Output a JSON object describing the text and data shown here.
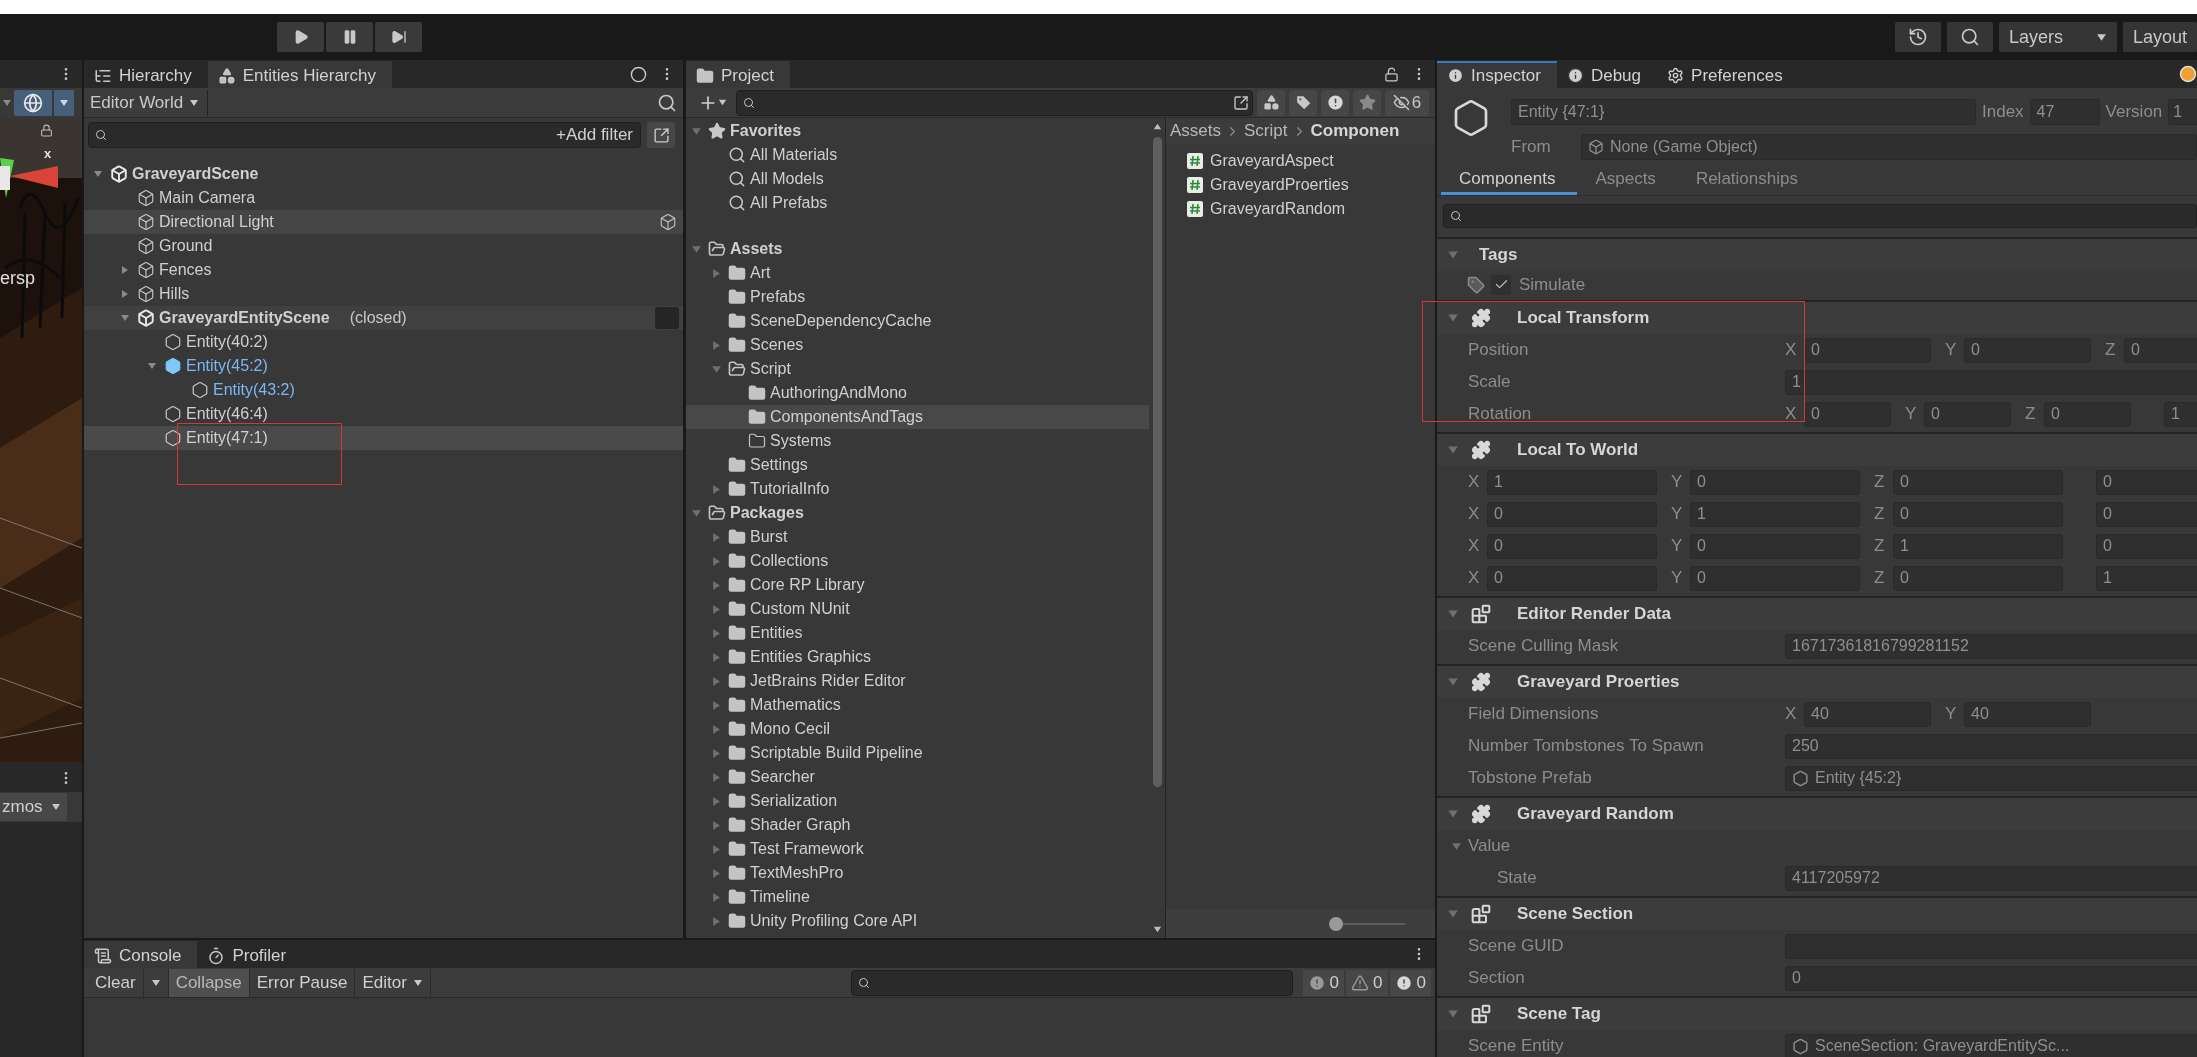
{
  "toolbar": {
    "layers": "Layers",
    "layout": "Layout"
  },
  "scene_view": {
    "view_label": "ersp",
    "axis_label": "x",
    "gizmos": "zmos"
  },
  "hierarchy": {
    "tabs": [
      {
        "label": "Hierarchy",
        "kind": "list",
        "selected": false
      },
      {
        "label": "Entities Hierarchy",
        "kind": "entities",
        "selected": true
      }
    ],
    "world": "Editor World",
    "add_filter": "+Add filter",
    "items": [
      {
        "label": "GraveyardScene",
        "kind": "scene",
        "expanded": true,
        "selected": false,
        "hovered": false,
        "children": [
          {
            "label": "Main Camera",
            "kind": "gameobject",
            "selected": false,
            "hovered": false
          },
          {
            "label": "Directional Light",
            "kind": "gameobject",
            "selected": false,
            "hovered": true
          },
          {
            "label": "Ground",
            "kind": "gameobject",
            "selected": false,
            "hovered": false
          },
          {
            "label": "Fences",
            "kind": "gameobject",
            "expanded": false,
            "selected": false,
            "hovered": false
          },
          {
            "label": "Hills",
            "kind": "gameobject",
            "expanded": false,
            "selected": false,
            "hovered": false
          },
          {
            "label": "GraveyardEntityScene",
            "note": "(closed)",
            "kind": "subscene",
            "expanded": true,
            "checked": false,
            "selected": false,
            "hovered": false,
            "children": [
              {
                "label": "Entity(40:2)",
                "kind": "entity",
                "selected": false,
                "hovered": false
              },
              {
                "label": "Entity(45:2)",
                "kind": "prefab-root",
                "expanded": true,
                "selected": false,
                "hovered": false,
                "children": [
                  {
                    "label": "Entity(43:2)",
                    "kind": "prefab-part",
                    "selected": false,
                    "hovered": false
                  }
                ]
              },
              {
                "label": "Entity(46:4)",
                "kind": "entity",
                "selected": false,
                "hovered": false
              },
              {
                "label": "Entity(47:1)",
                "kind": "entity",
                "selected": true,
                "hovered": false
              }
            ]
          }
        ]
      }
    ]
  },
  "project": {
    "tabs": [
      {
        "label": "Project",
        "selected": true
      }
    ],
    "hidden_count": "6",
    "tree": [
      {
        "label": "Favorites",
        "kind": "favorites",
        "expanded": true,
        "selected": false,
        "children": [
          {
            "label": "All Materials",
            "kind": "search",
            "selected": false
          },
          {
            "label": "All Models",
            "kind": "search",
            "selected": false
          },
          {
            "label": "All Prefabs",
            "kind": "search",
            "selected": false
          }
        ]
      },
      {
        "label": "Assets",
        "kind": "folder",
        "expanded": true,
        "selected": false,
        "children": [
          {
            "label": "Art",
            "kind": "folder",
            "expanded": false,
            "selected": false
          },
          {
            "label": "Prefabs",
            "kind": "folder",
            "selected": false
          },
          {
            "label": "SceneDependencyCache",
            "kind": "folder",
            "selected": false
          },
          {
            "label": "Scenes",
            "kind": "folder",
            "expanded": false,
            "selected": false
          },
          {
            "label": "Script",
            "kind": "folder",
            "expanded": true,
            "selected": false,
            "children": [
              {
                "label": "AuthoringAndMono",
                "kind": "folder",
                "selected": false
              },
              {
                "label": "ComponentsAndTags",
                "kind": "folder",
                "selected": true
              },
              {
                "label": "Systems",
                "kind": "empty-folder",
                "selected": false
              }
            ]
          },
          {
            "label": "Settings",
            "kind": "folder",
            "selected": false
          },
          {
            "label": "TutorialInfo",
            "kind": "folder",
            "expanded": false,
            "selected": false
          }
        ]
      },
      {
        "label": "Packages",
        "kind": "folder",
        "expanded": true,
        "selected": false,
        "children": [
          {
            "label": "Burst",
            "kind": "folder",
            "expanded": false,
            "selected": false
          },
          {
            "label": "Collections",
            "kind": "folder",
            "expanded": false,
            "selected": false
          },
          {
            "label": "Core RP Library",
            "kind": "folder",
            "expanded": false,
            "selected": false
          },
          {
            "label": "Custom NUnit",
            "kind": "folder",
            "expanded": false,
            "selected": false
          },
          {
            "label": "Entities",
            "kind": "folder",
            "expanded": false,
            "selected": false
          },
          {
            "label": "Entities Graphics",
            "kind": "folder",
            "expanded": false,
            "selected": false
          },
          {
            "label": "JetBrains Rider Editor",
            "kind": "folder",
            "expanded": false,
            "selected": false
          },
          {
            "label": "Mathematics",
            "kind": "folder",
            "expanded": false,
            "selected": false
          },
          {
            "label": "Mono Cecil",
            "kind": "folder",
            "expanded": false,
            "selected": false
          },
          {
            "label": "Scriptable Build Pipeline",
            "kind": "folder",
            "expanded": false,
            "selected": false
          },
          {
            "label": "Searcher",
            "kind": "folder",
            "expanded": false,
            "selected": false
          },
          {
            "label": "Serialization",
            "kind": "folder",
            "expanded": false,
            "selected": false
          },
          {
            "label": "Shader Graph",
            "kind": "folder",
            "expanded": false,
            "selected": false
          },
          {
            "label": "Test Framework",
            "kind": "folder",
            "expanded": false,
            "selected": false
          },
          {
            "label": "TextMeshPro",
            "kind": "folder",
            "expanded": false,
            "selected": false
          },
          {
            "label": "Timeline",
            "kind": "folder",
            "expanded": false,
            "selected": false
          },
          {
            "label": "Unity Profiling Core API",
            "kind": "folder",
            "expanded": false,
            "selected": false
          }
        ]
      }
    ],
    "breadcrumb": [
      "Assets",
      "Script",
      "Componen"
    ],
    "files": [
      "GraveyardAspect",
      "GraveyardProerties",
      "GraveyardRandom"
    ],
    "zoom": {
      "level": 0
    }
  },
  "inspector": {
    "tabs": [
      {
        "label": "Inspector",
        "kind": "info",
        "selected": true
      },
      {
        "label": "Debug",
        "kind": "info",
        "selected": false
      },
      {
        "label": "Preferences",
        "kind": "settings",
        "selected": false
      }
    ],
    "entity": {
      "name": "Entity {47:1}",
      "index_label": "Index",
      "index": "47",
      "version_label": "Version",
      "version": "1",
      "from_label": "From",
      "from": "None (Game Object)"
    },
    "subtabs": [
      {
        "label": "Components",
        "selected": true
      },
      {
        "label": "Aspects",
        "selected": false
      },
      {
        "label": "Relationships",
        "selected": false
      }
    ],
    "sections": [
      {
        "title": "Tags",
        "kind": "tags",
        "expanded": true,
        "rows": [
          {
            "kind": "tag",
            "label": "Simulate",
            "checked": true
          }
        ]
      },
      {
        "title": "Local Transform",
        "kind": "component",
        "expanded": true,
        "rows": [
          {
            "kind": "vector",
            "label": "Position",
            "fields": [
              {
                "axis": "X",
                "value": "0"
              },
              {
                "axis": "Y",
                "value": "0"
              },
              {
                "axis": "Z",
                "value": "0"
              }
            ]
          },
          {
            "kind": "value",
            "label": "Scale",
            "value": "1"
          },
          {
            "kind": "vector",
            "label": "Rotation",
            "fields": [
              {
                "axis": "X",
                "value": "0"
              },
              {
                "axis": "Y",
                "value": "0"
              },
              {
                "axis": "Z",
                "value": "0"
              },
              {
                "value": "1"
              }
            ]
          }
        ]
      },
      {
        "title": "Local To World",
        "kind": "component",
        "expanded": true,
        "rows": [
          {
            "kind": "vector",
            "fields": [
              {
                "axis": "X",
                "value": "1"
              },
              {
                "axis": "Y",
                "value": "0"
              },
              {
                "axis": "Z",
                "value": "0"
              },
              {
                "value": "0"
              }
            ]
          },
          {
            "kind": "vector",
            "fields": [
              {
                "axis": "X",
                "value": "0"
              },
              {
                "axis": "Y",
                "value": "1"
              },
              {
                "axis": "Z",
                "value": "0"
              },
              {
                "value": "0"
              }
            ]
          },
          {
            "kind": "vector",
            "fields": [
              {
                "axis": "X",
                "value": "0"
              },
              {
                "axis": "Y",
                "value": "0"
              },
              {
                "axis": "Z",
                "value": "1"
              },
              {
                "value": "0"
              }
            ]
          },
          {
            "kind": "vector",
            "fields": [
              {
                "axis": "X",
                "value": "0"
              },
              {
                "axis": "Y",
                "value": "0"
              },
              {
                "axis": "Z",
                "value": "0"
              },
              {
                "value": "1"
              }
            ]
          }
        ]
      },
      {
        "title": "Editor Render Data",
        "kind": "shared",
        "expanded": true,
        "rows": [
          {
            "kind": "value",
            "label": "Scene Culling Mask",
            "value": "16717361816799281152"
          }
        ]
      },
      {
        "title": "Graveyard Proerties",
        "kind": "component",
        "expanded": true,
        "rows": [
          {
            "kind": "vector",
            "label": "Field Dimensions",
            "fields": [
              {
                "axis": "X",
                "value": "40"
              },
              {
                "axis": "Y",
                "value": "40"
              }
            ]
          },
          {
            "kind": "value",
            "label": "Number Tombstones To Spawn",
            "value": "250"
          },
          {
            "kind": "object",
            "label": "Tobstone Prefab",
            "value": "Entity {45:2}"
          }
        ]
      },
      {
        "title": "Graveyard Random",
        "kind": "component",
        "expanded": true,
        "rows": [
          {
            "kind": "foldout",
            "label": "Value",
            "expanded": true,
            "children": [
              {
                "kind": "value",
                "label": "State",
                "value": "4117205972"
              }
            ]
          }
        ]
      },
      {
        "title": "Scene Section",
        "kind": "shared",
        "expanded": true,
        "rows": [
          {
            "kind": "value",
            "label": "Scene GUID"
          },
          {
            "kind": "value",
            "label": "Section",
            "value": "0"
          }
        ]
      },
      {
        "title": "Scene Tag",
        "kind": "shared",
        "expanded": true,
        "rows": [
          {
            "kind": "object",
            "label": "Scene Entity",
            "value": "SceneSection: GraveyardEntitySc..."
          }
        ]
      }
    ]
  },
  "console": {
    "tabs": [
      {
        "label": "Console",
        "kind": "log",
        "selected": true
      },
      {
        "label": "Profiler",
        "kind": "profiler",
        "selected": false
      }
    ],
    "clear": "Clear",
    "toggles": [
      {
        "label": "Collapse",
        "on": true
      },
      {
        "label": "Error Pause",
        "on": false
      }
    ],
    "editor": "Editor",
    "counters": [
      {
        "kind": "info",
        "count": "0"
      },
      {
        "kind": "warning",
        "count": "0"
      },
      {
        "kind": "error",
        "count": "0"
      }
    ]
  }
}
